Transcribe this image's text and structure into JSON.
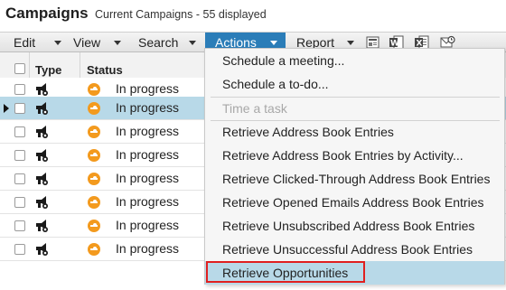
{
  "header": {
    "title": "Campaigns",
    "subtitle": "Current Campaigns - 55 displayed"
  },
  "toolbar": {
    "edit_label": "Edit",
    "view_label": "View",
    "search_label": "Search",
    "actions_label": "Actions",
    "report_label": "Report",
    "icons": [
      "export-form-icon",
      "word-export-icon",
      "excel-export-icon",
      "email-export-icon"
    ]
  },
  "grid": {
    "columns": [
      "Type",
      "Status"
    ],
    "rows": [
      {
        "status": "In progress",
        "selected": false
      },
      {
        "status": "In progress",
        "selected": true
      },
      {
        "status": "In progress",
        "selected": false
      },
      {
        "status": "In progress",
        "selected": false
      },
      {
        "status": "In progress",
        "selected": false
      },
      {
        "status": "In progress",
        "selected": false
      },
      {
        "status": "In progress",
        "selected": false
      },
      {
        "status": "In progress",
        "selected": false
      }
    ]
  },
  "actions_menu": {
    "items": [
      {
        "label": "Schedule a meeting...",
        "disabled": false
      },
      {
        "label": "Schedule a to-do...",
        "disabled": false
      },
      {
        "label": "Time a task",
        "disabled": true
      },
      {
        "label": "Retrieve Address Book Entries",
        "disabled": false
      },
      {
        "label": "Retrieve Address Book Entries by Activity...",
        "disabled": false
      },
      {
        "label": "Retrieve Clicked-Through Address Book Entries",
        "disabled": false
      },
      {
        "label": "Retrieve Opened Emails Address Book Entries",
        "disabled": false
      },
      {
        "label": "Retrieve Unsubscribed Address Book Entries",
        "disabled": false
      },
      {
        "label": "Retrieve Unsuccessful Address Book Entries",
        "disabled": false
      },
      {
        "label": "Retrieve Opportunities",
        "disabled": false
      }
    ]
  },
  "colors": {
    "accent": "#2b7db8",
    "selection": "#b8d9e8",
    "status": "#f39a1e",
    "highlight_border": "#e02020"
  }
}
